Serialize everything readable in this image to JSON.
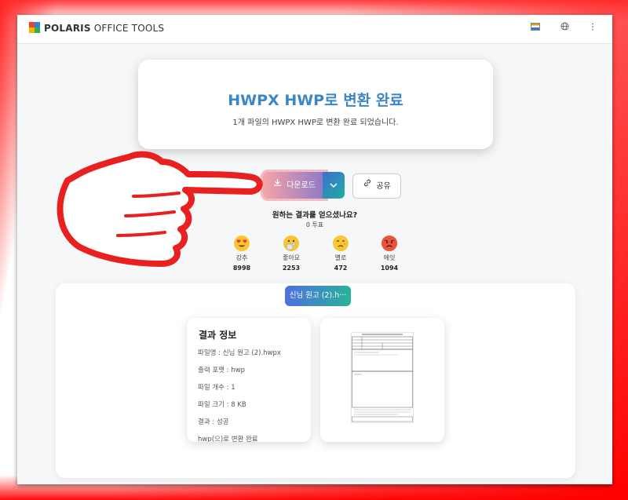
{
  "brand": {
    "name_bold": "POLARIS",
    "name_rest": " OFFICE TOOLS"
  },
  "topbar_icons": [
    "mail-icon",
    "globe-icon",
    "more-vert-icon"
  ],
  "hero": {
    "title": "HWPX HWP로 변환 완료",
    "subtitle": "1개 파일의 HWPX HWP로 변환 완료 되었습니다."
  },
  "actions": {
    "back_symbol": "←",
    "download_label": "다운로드",
    "download_icon": "download-icon",
    "dropdown_symbol": "⌄",
    "share_label": "공유",
    "share_icon": "link-icon"
  },
  "feedback": {
    "question": "원하는 결과를 얻으셨나요?",
    "votes": "0 투표",
    "reactions": [
      {
        "label": "강추",
        "count": "8998",
        "icon": "heart-eyes-emoji"
      },
      {
        "label": "좋아요",
        "count": "2253",
        "icon": "thumbs-up-emoji"
      },
      {
        "label": "별로",
        "count": "472",
        "icon": "disappointed-emoji"
      },
      {
        "label": "에잇",
        "count": "1094",
        "icon": "angry-emoji"
      }
    ]
  },
  "result": {
    "file_tab": "신님 원고 (2).h···",
    "info_title": "결과 정보",
    "lines": [
      "파일명 : 신님 원고 (2).hwpx",
      "출력 포맷 : hwp",
      "파일 개수 : 1",
      "파일 크기 : 8 KB",
      "결과 : 성공",
      "hwp(으)로 변환 완료"
    ]
  },
  "colors": {
    "accent": "#3d86c6",
    "overlay_hand": "#e82020"
  }
}
